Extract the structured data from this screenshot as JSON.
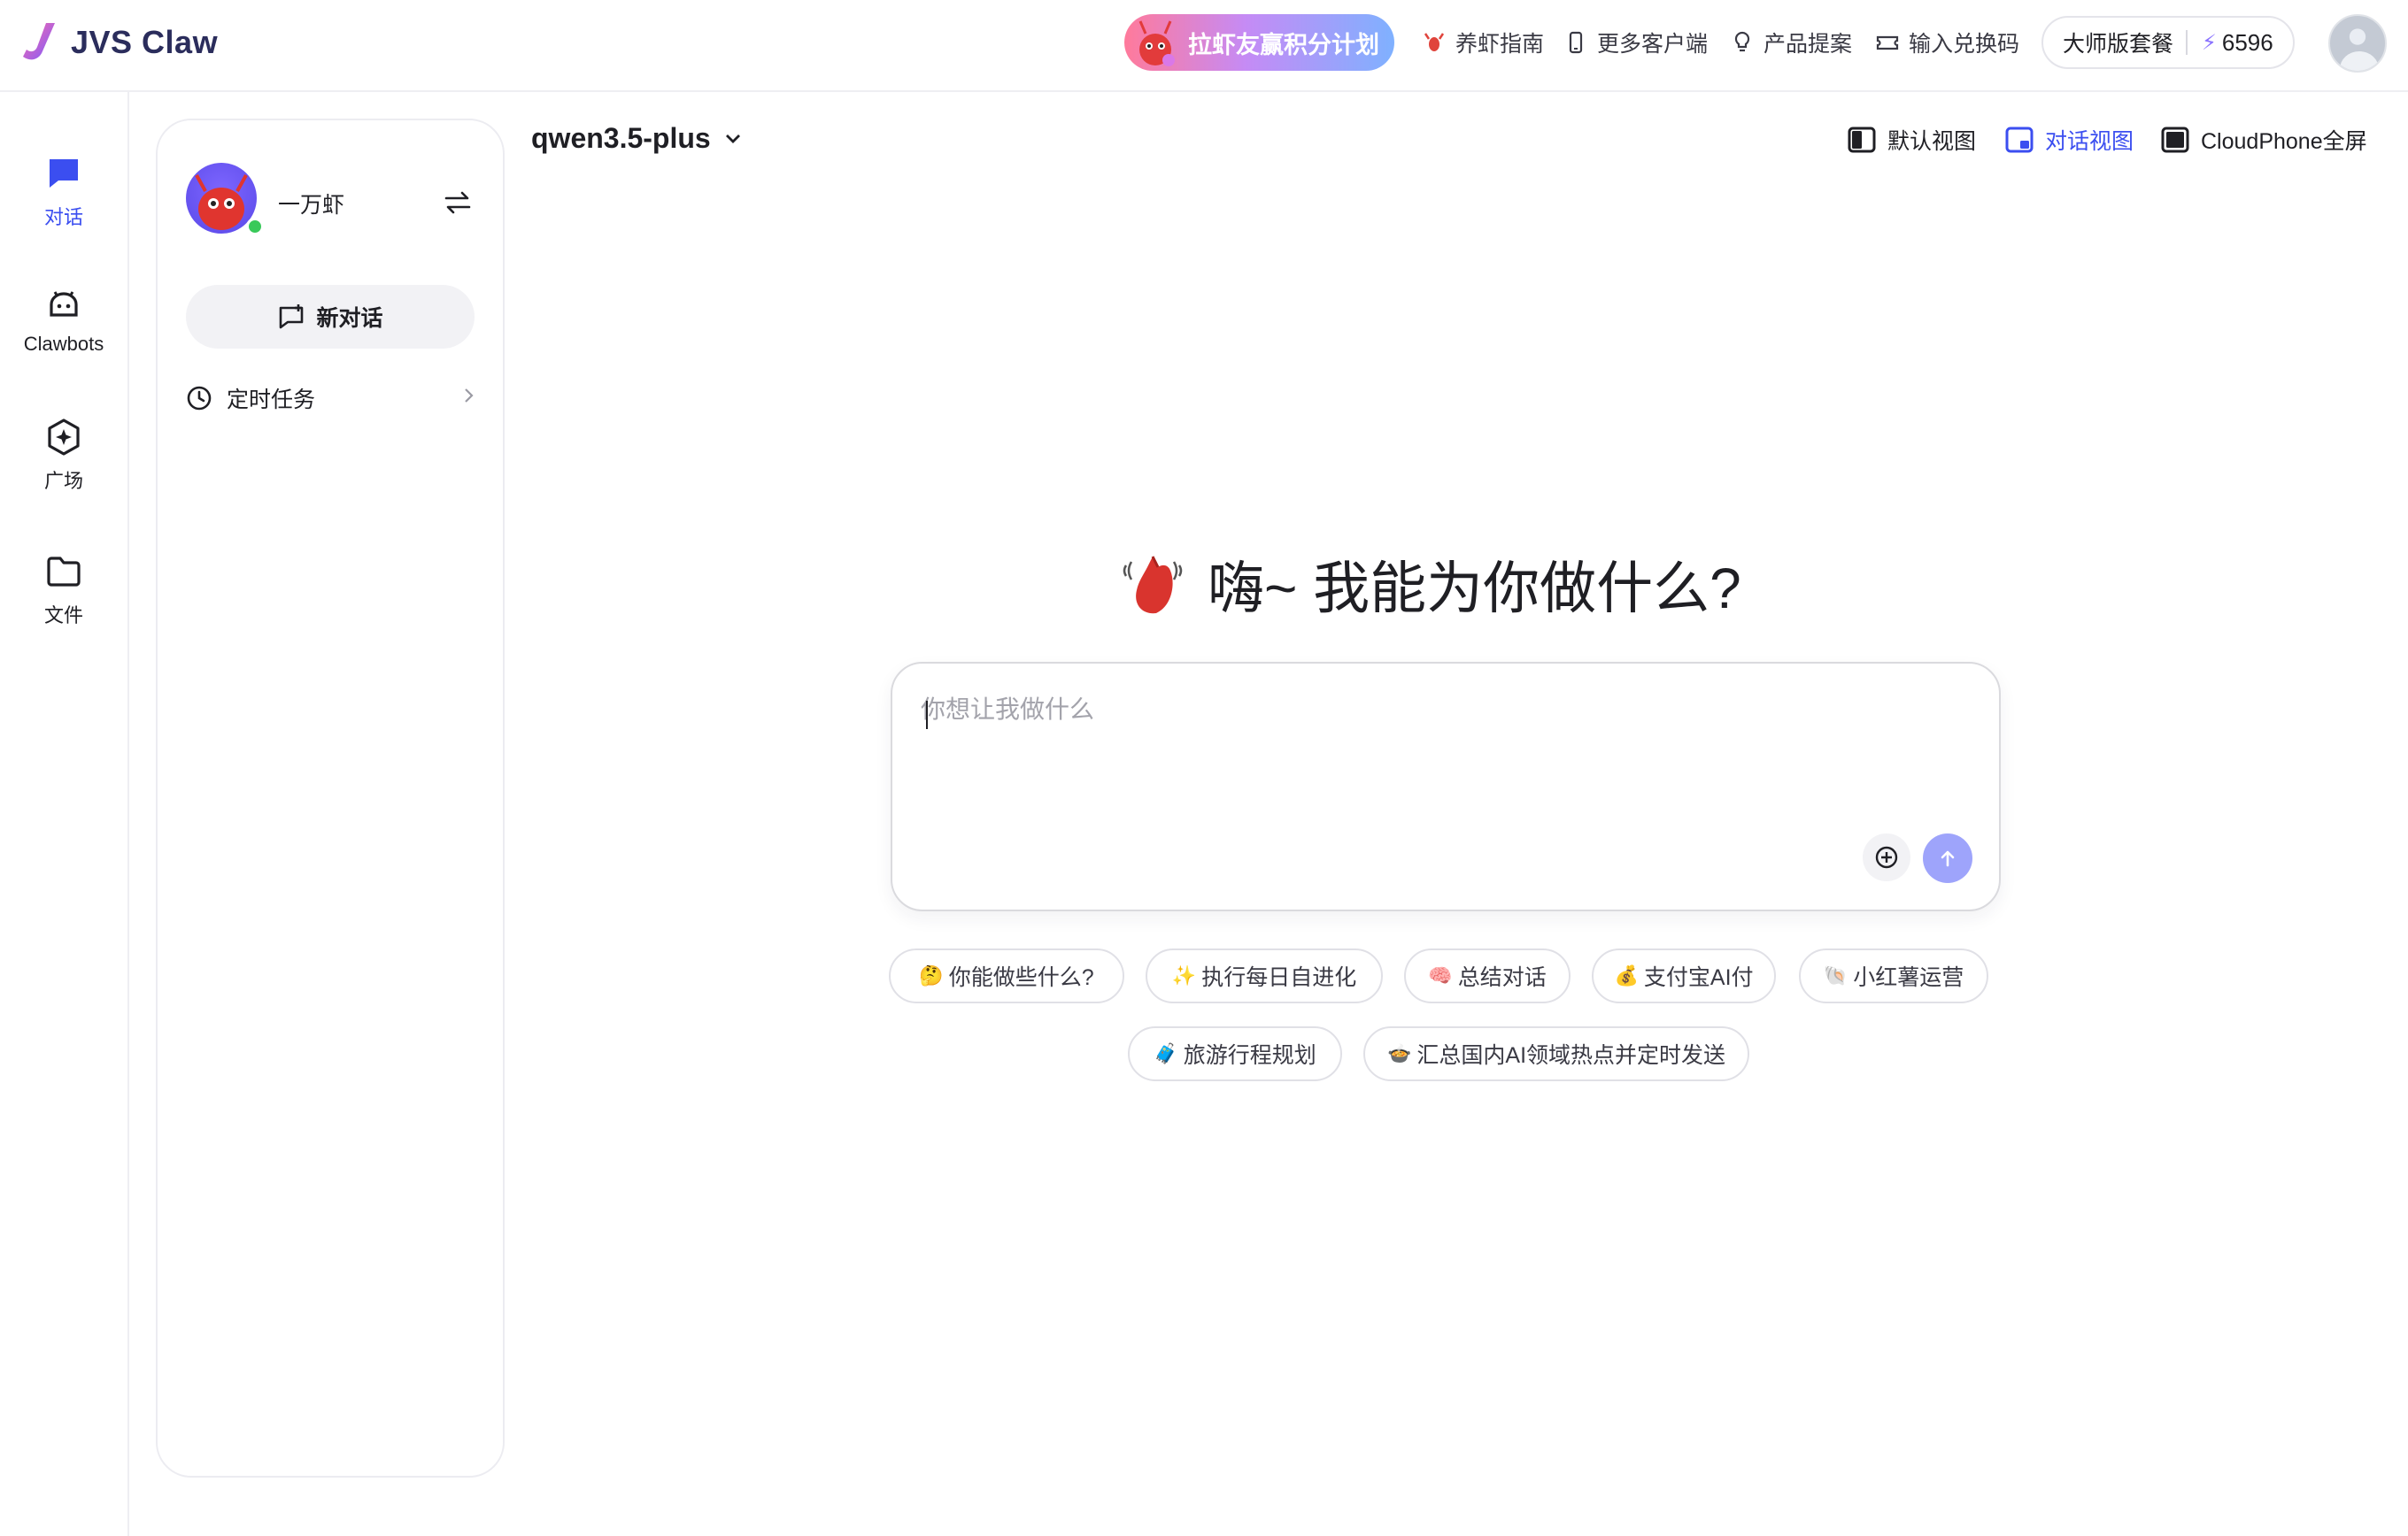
{
  "app": {
    "name": "JVS Claw"
  },
  "topbar": {
    "promo_label": "拉虾友赢积分计划",
    "nav": [
      {
        "label": "养虾指南",
        "icon": "lobster-icon"
      },
      {
        "label": "更多客户端",
        "icon": "phone-icon"
      },
      {
        "label": "产品提案",
        "icon": "lightbulb-icon"
      },
      {
        "label": "输入兑换码",
        "icon": "ticket-icon"
      }
    ],
    "plan_label": "大师版套餐",
    "credits": "6596"
  },
  "rail": {
    "items": [
      {
        "label": "对话",
        "icon": "chat-bubble-icon",
        "active": true
      },
      {
        "label": "Clawbots",
        "icon": "bot-icon",
        "active": false
      },
      {
        "label": "广场",
        "icon": "sparkle-hexagon-icon",
        "active": false
      },
      {
        "label": "文件",
        "icon": "folder-icon",
        "active": false
      }
    ]
  },
  "panel": {
    "agent_name": "一万虾",
    "new_chat_label": "新对话",
    "scheduled_tasks_label": "定时任务"
  },
  "main": {
    "model_name": "qwen3.5-plus",
    "views": [
      {
        "label": "默认视图",
        "active": false
      },
      {
        "label": "对话视图",
        "active": true
      },
      {
        "label": "CloudPhone全屏",
        "active": false
      }
    ],
    "greeting": "嗨~ 我能为你做什么?",
    "composer_placeholder": "你想让我做什么",
    "suggestions_row1": [
      {
        "icon": "🤔",
        "label": "你能做些什么?"
      },
      {
        "icon": "✨",
        "label": "执行每日自进化"
      },
      {
        "icon": "🧠",
        "label": "总结对话"
      },
      {
        "icon": "💰",
        "label": "支付宝AI付"
      },
      {
        "icon": "🐚",
        "label": "小红薯运营"
      }
    ],
    "suggestions_row2": [
      {
        "icon": "🧳",
        "label": "旅游行程规划"
      },
      {
        "icon": "🍲",
        "label": "汇总国内AI领域热点并定时发送"
      }
    ]
  },
  "colors": {
    "accent": "#3b4ef0",
    "send_button": "#9ea4fb",
    "online": "#39c95a"
  }
}
